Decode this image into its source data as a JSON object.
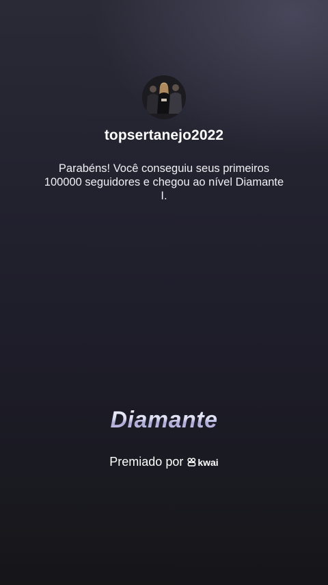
{
  "profile": {
    "username": "topsertanejo2022"
  },
  "message": "Parabéns! Você conseguiu seus primeiros 100000 seguidores e chegou ao nível Diamante I.",
  "level": {
    "title": "Diamante"
  },
  "award": {
    "label": "Premiado por",
    "brand_name": "kwai",
    "brand_icon": "kwai-logo-icon"
  },
  "colors": {
    "background_top": "#2a2a36",
    "background_bottom": "#161619",
    "text": "#ffffff"
  }
}
